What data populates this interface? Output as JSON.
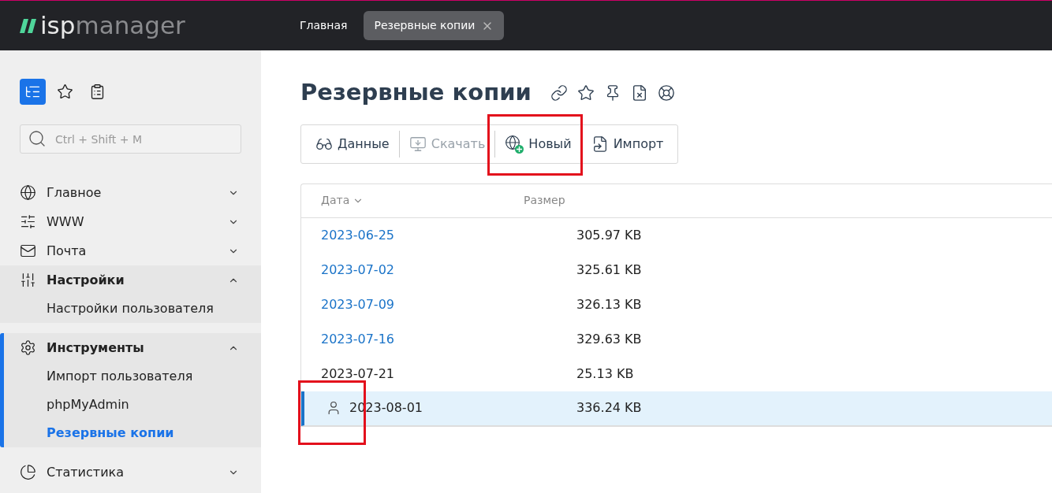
{
  "header": {
    "logo_left": "isp",
    "logo_right": "manager",
    "tabs": [
      {
        "label": "Главная",
        "selected": false
      },
      {
        "label": "Резервные копии",
        "selected": true
      }
    ]
  },
  "sidebar": {
    "modes": [
      {
        "kind": "tree",
        "selected": true
      },
      {
        "kind": "star",
        "selected": false
      },
      {
        "kind": "badge",
        "selected": false
      }
    ],
    "search": {
      "placeholder": "Ctrl + Shift + M"
    },
    "groups": [
      {
        "label": "Главное",
        "expanded": false
      },
      {
        "label": "WWW",
        "expanded": false
      },
      {
        "label": "Почта",
        "expanded": false
      },
      {
        "label": "Настройки",
        "expanded": true,
        "children": [
          {
            "label": "Настройки пользователя",
            "selected": false
          }
        ]
      },
      {
        "label": "Инструменты",
        "expanded": true,
        "children": [
          {
            "label": "Импорт пользователя",
            "selected": false
          },
          {
            "label": "phpMyAdmin",
            "selected": false
          },
          {
            "label": "Резервные копии",
            "selected": true
          }
        ]
      },
      {
        "label": "Статистика",
        "expanded": false
      }
    ]
  },
  "page": {
    "title": "Резервные копии",
    "toolbar": [
      {
        "label": "Данные",
        "disabled": false,
        "highlighted": false
      },
      {
        "label": "Скачать",
        "disabled": true,
        "highlighted": false
      },
      {
        "label": "Новый",
        "disabled": false,
        "highlighted": true
      },
      {
        "label": "Импорт",
        "disabled": false,
        "highlighted": false
      }
    ],
    "table": {
      "columns": [
        "Дата",
        "Размер"
      ],
      "rows": [
        {
          "kind": "link",
          "date": "2023-06-25",
          "size": "305.97 KB",
          "selected": false,
          "highlighted": false
        },
        {
          "kind": "link",
          "date": "2023-07-02",
          "size": "325.61 KB",
          "selected": false,
          "highlighted": false
        },
        {
          "kind": "link",
          "date": "2023-07-09",
          "size": "326.13 KB",
          "selected": false,
          "highlighted": false
        },
        {
          "kind": "link",
          "date": "2023-07-16",
          "size": "329.63 KB",
          "selected": false,
          "highlighted": false
        },
        {
          "kind": "plain",
          "date": "2023-07-21",
          "size": "25.13 KB",
          "selected": false,
          "highlighted": false
        },
        {
          "kind": "user",
          "date": "2023-08-01",
          "size": "336.24 KB",
          "selected": true,
          "highlighted": true
        }
      ]
    }
  }
}
